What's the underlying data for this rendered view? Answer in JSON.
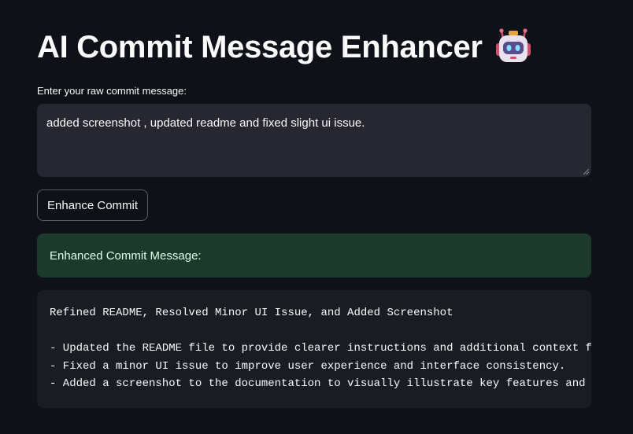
{
  "header": {
    "title": "AI Commit Message Enhancer",
    "title_icon": "robot-icon"
  },
  "input": {
    "label": "Enter your raw commit message:",
    "value": "added screenshot , updated readme and fixed slight ui issue."
  },
  "actions": {
    "enhance_label": "Enhance Commit"
  },
  "result": {
    "success_label": "Enhanced Commit Message:",
    "lines": [
      "Refined README, Resolved Minor UI Issue, and Added Screenshot",
      "",
      "- Updated the README file to provide clearer instructions and additional context f",
      "- Fixed a minor UI issue to improve user experience and interface consistency.",
      "- Added a screenshot to the documentation to visually illustrate key features and"
    ]
  },
  "colors": {
    "background": "#0e1117",
    "input_bg": "#262730",
    "success_bg": "#1b3a2b",
    "success_text": "#dffde9",
    "code_bg": "#1a1c24"
  }
}
